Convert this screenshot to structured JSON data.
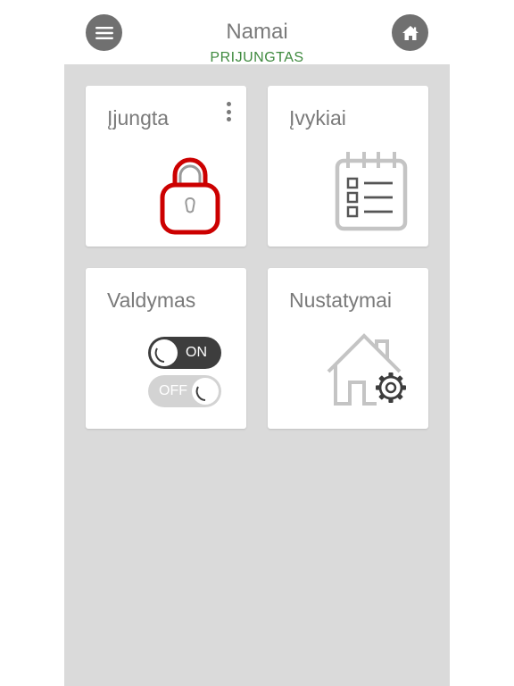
{
  "header": {
    "title": "Namai",
    "status": "PRIJUNGTAS",
    "menu_icon": "hamburger-menu-icon",
    "home_icon": "home-icon"
  },
  "cards": {
    "arm": {
      "title": "Įjungta",
      "icon": "padlock-icon",
      "more_icon": "more-vert-icon"
    },
    "events": {
      "title": "Įvykiai",
      "icon": "calendar-list-icon"
    },
    "control": {
      "title": "Valdymas",
      "toggle_on_label": "ON",
      "toggle_off_label": "OFF"
    },
    "settings": {
      "title": "Nustatymai",
      "icon": "house-gear-icon"
    }
  },
  "colors": {
    "status_green": "#3f8a3f",
    "lock_red": "#cc0000",
    "panel_background": "#dadada",
    "icon_gray": "#c4c4c4",
    "text_gray": "#7a7a7a"
  }
}
